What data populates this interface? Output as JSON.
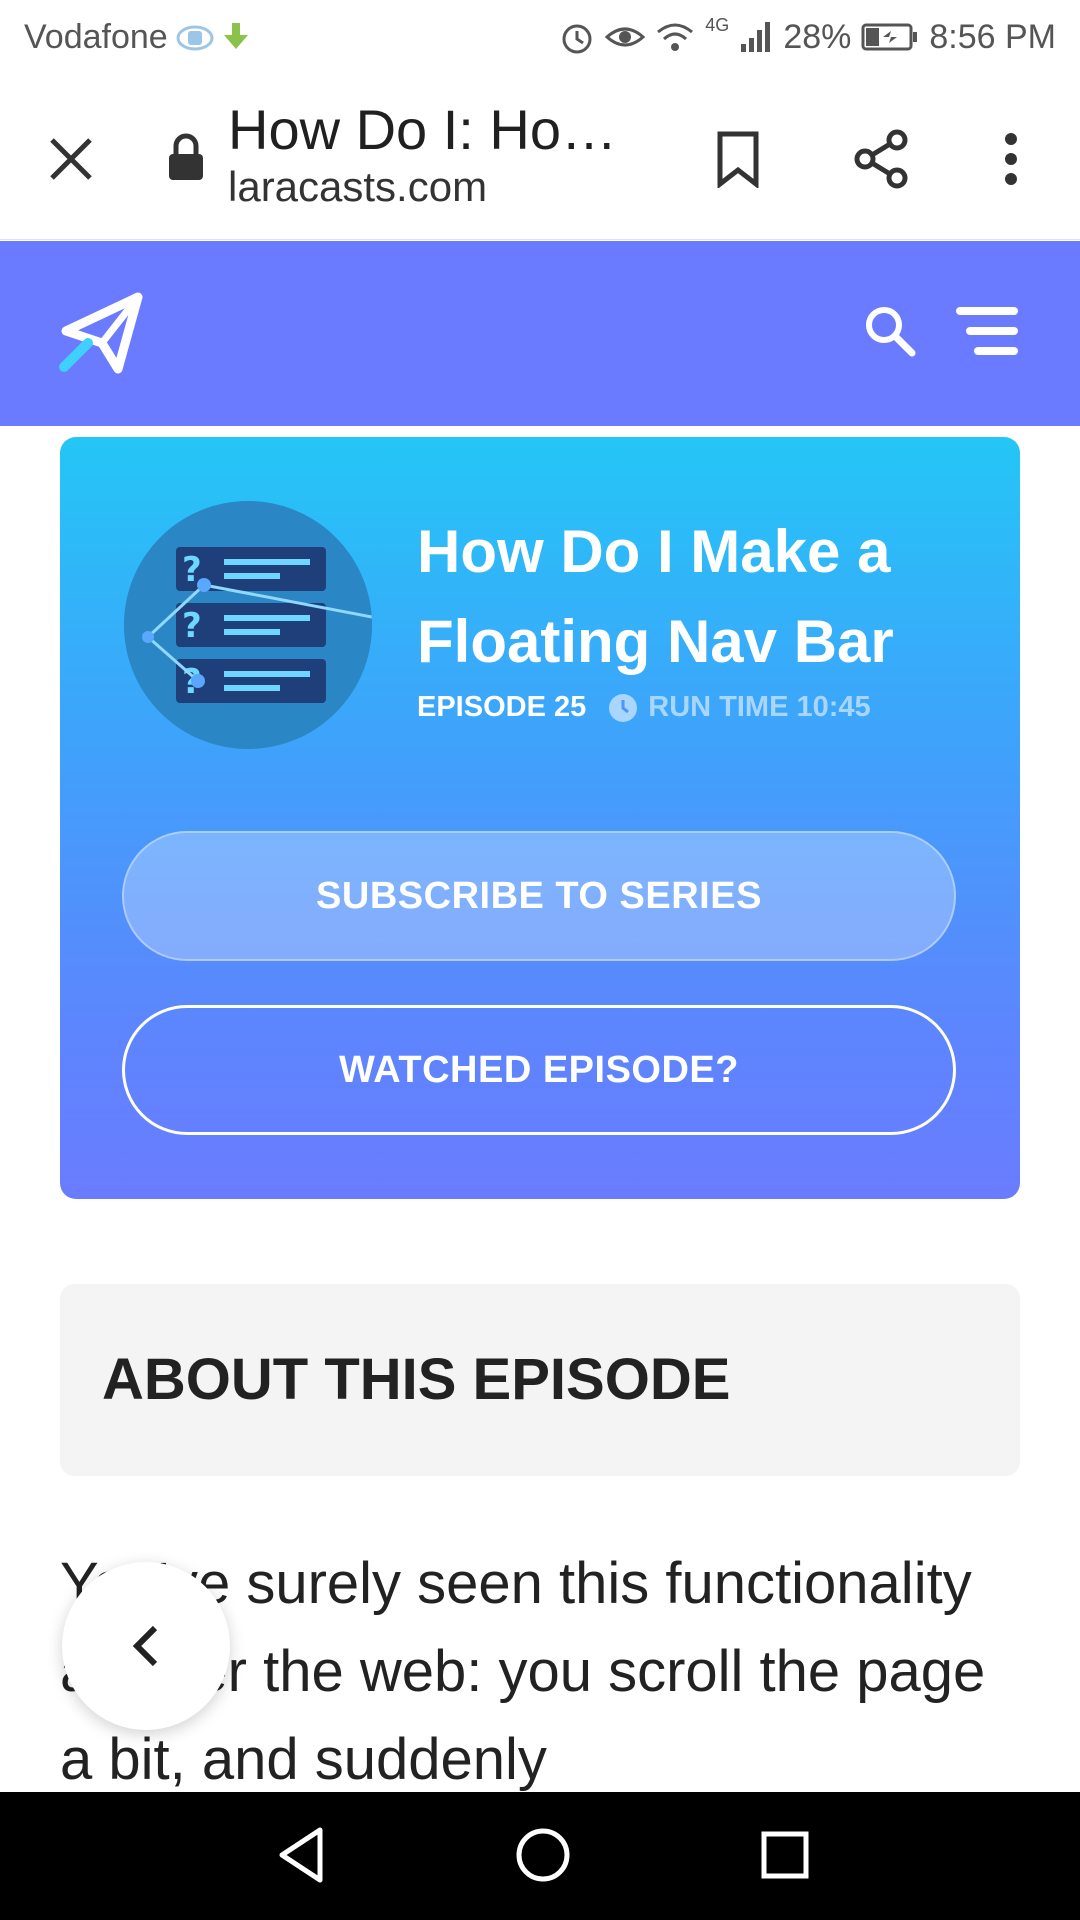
{
  "status_bar": {
    "carrier": "Vodafone",
    "network": "4G",
    "battery": "28%",
    "time": "8:56 PM"
  },
  "browser": {
    "tab_title": "How Do I: Ho…",
    "domain": "laracasts.com"
  },
  "hero": {
    "title": "How Do I Make a Floating Nav Bar",
    "episode": "EPISODE 25",
    "runtime": "RUN TIME 10:45",
    "subscribe_label": "SUBSCRIBE TO SERIES",
    "watched_label": "WATCHED EPISODE?"
  },
  "about": {
    "heading": "ABOUT THIS EPISODE",
    "body": "You've surely seen this functionality all over the web: you scroll the page a bit, and suddenly"
  },
  "colors": {
    "header_bg": "#6b7bff",
    "hero_top": "#24c6f6",
    "hero_bottom": "#6a7cfe"
  }
}
